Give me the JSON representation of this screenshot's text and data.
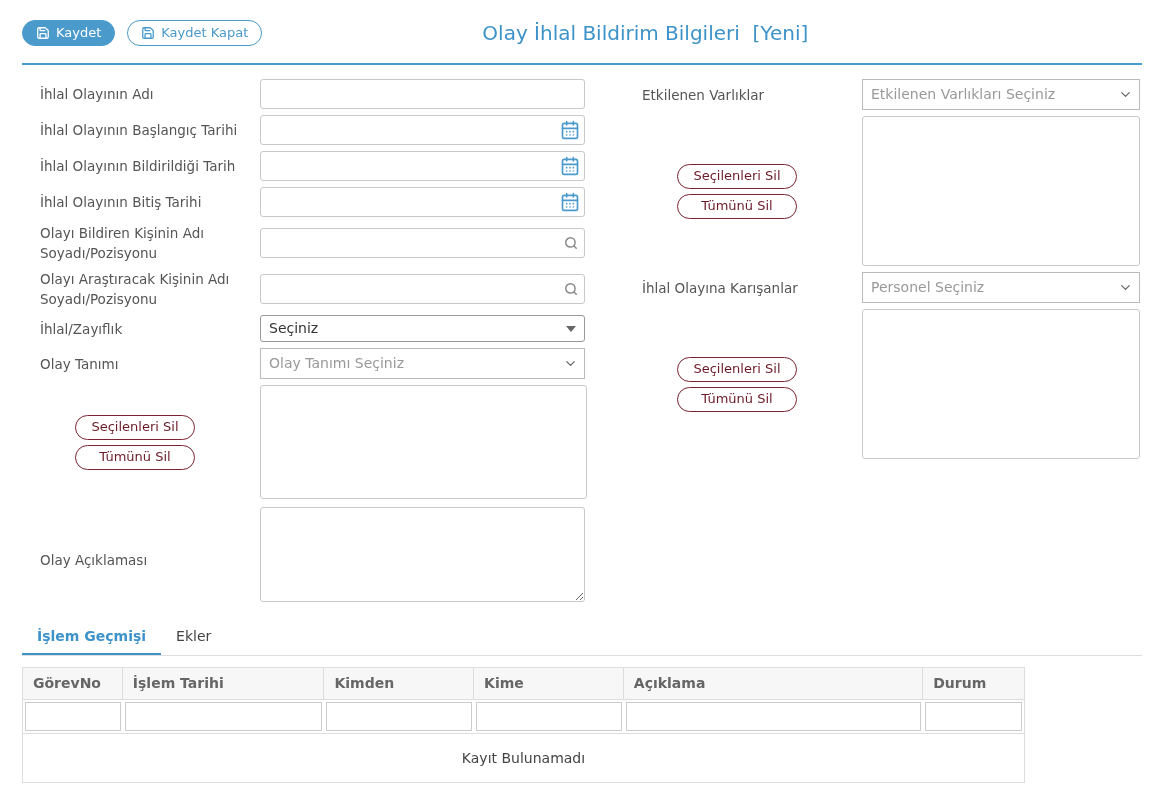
{
  "toolbar": {
    "buttons": [
      {
        "label": "Kaydet",
        "kind": "primary"
      },
      {
        "label": "Kaydet Kapat",
        "kind": "outline"
      }
    ]
  },
  "title": {
    "text": "Olay İhlal Bildirim Bilgileri",
    "badge": "[Yeni]"
  },
  "left_fields": [
    {
      "label": "İhlal Olayının Adı",
      "kind": "text"
    },
    {
      "label": "İhlal Olayının Başlangıç Tarihi",
      "kind": "date"
    },
    {
      "label": "İhlal Olayının Bildirildiği Tarih",
      "kind": "date"
    },
    {
      "label": "İhlal Olayının Bitiş Tarihi",
      "kind": "date"
    },
    {
      "label": "Olayı Bildiren Kişinin Adı Soyadı/Pozisyonu",
      "kind": "search"
    },
    {
      "label": "Olayı Araştıracak Kişinin Adı Soyadı/Pozisyonu",
      "kind": "search"
    },
    {
      "label": "İhlal/Zayıflık",
      "kind": "select",
      "value": "Seçiniz"
    },
    {
      "label": "Olay Tanımı",
      "kind": "combo",
      "placeholder": "Olay Tanımı Seçiniz"
    },
    {
      "kind": "listbox",
      "buttons": [
        "Seçilenleri Sil",
        "Tümünü Sil"
      ]
    },
    {
      "label": "Olay Açıklaması",
      "kind": "textarea"
    }
  ],
  "right_fields": [
    {
      "label": "Etkilenen Varlıklar",
      "kind": "combo",
      "placeholder": "Etkilenen Varlıkları Seçiniz"
    },
    {
      "kind": "listbox",
      "buttons": [
        "Seçilenleri Sil",
        "Tümünü Sil"
      ]
    },
    {
      "label": "İhlal Olayına Karışanlar",
      "kind": "combo",
      "placeholder": "Personel Seçiniz"
    },
    {
      "kind": "listbox",
      "buttons": [
        "Seçilenleri Sil",
        "Tümünü Sil"
      ]
    }
  ],
  "tabs": [
    {
      "label": "İşlem Geçmişi",
      "selected": true
    },
    {
      "label": "Ekler",
      "selected": false
    }
  ],
  "table": {
    "columns": [
      "GörevNo",
      "İşlem Tarihi",
      "Kimden",
      "Kime",
      "Açıklama",
      "Durum"
    ],
    "empty_message": "Kayıt Bulunamadı"
  }
}
